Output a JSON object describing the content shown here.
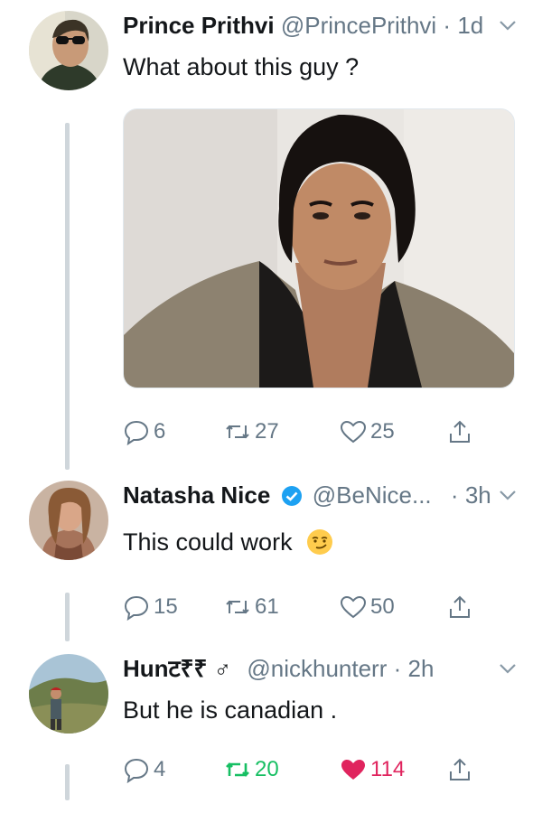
{
  "tweets": [
    {
      "name": "Prince Prithvi",
      "handle": "@PrincePrithvi",
      "dot": "·",
      "time": "1d",
      "text": "What about this guy ?",
      "replies": "6",
      "retweets": "27",
      "likes": "25",
      "avatar_icon": "user-avatar-sunglasses",
      "has_photo": true
    },
    {
      "name": "Natasha Nice",
      "verified": true,
      "handle": "@BeNice...",
      "dot": "·",
      "time": "3h",
      "text": "This could work",
      "emoji": "smirking-face-emoji",
      "replies": "15",
      "retweets": "61",
      "likes": "50"
    },
    {
      "name": "Hunट₹₹ ♂",
      "handle": "@nickhunterr",
      "dot": "·",
      "time": "2h",
      "text": "But he is canadian .",
      "replies": "4",
      "retweets": "20",
      "likes": "114",
      "retweeted": true,
      "liked": true
    }
  ],
  "colors": {
    "gray": "#657786",
    "retweet_green": "#17bf63",
    "like_red": "#e0245e",
    "verified_blue": "#1da1f2"
  }
}
